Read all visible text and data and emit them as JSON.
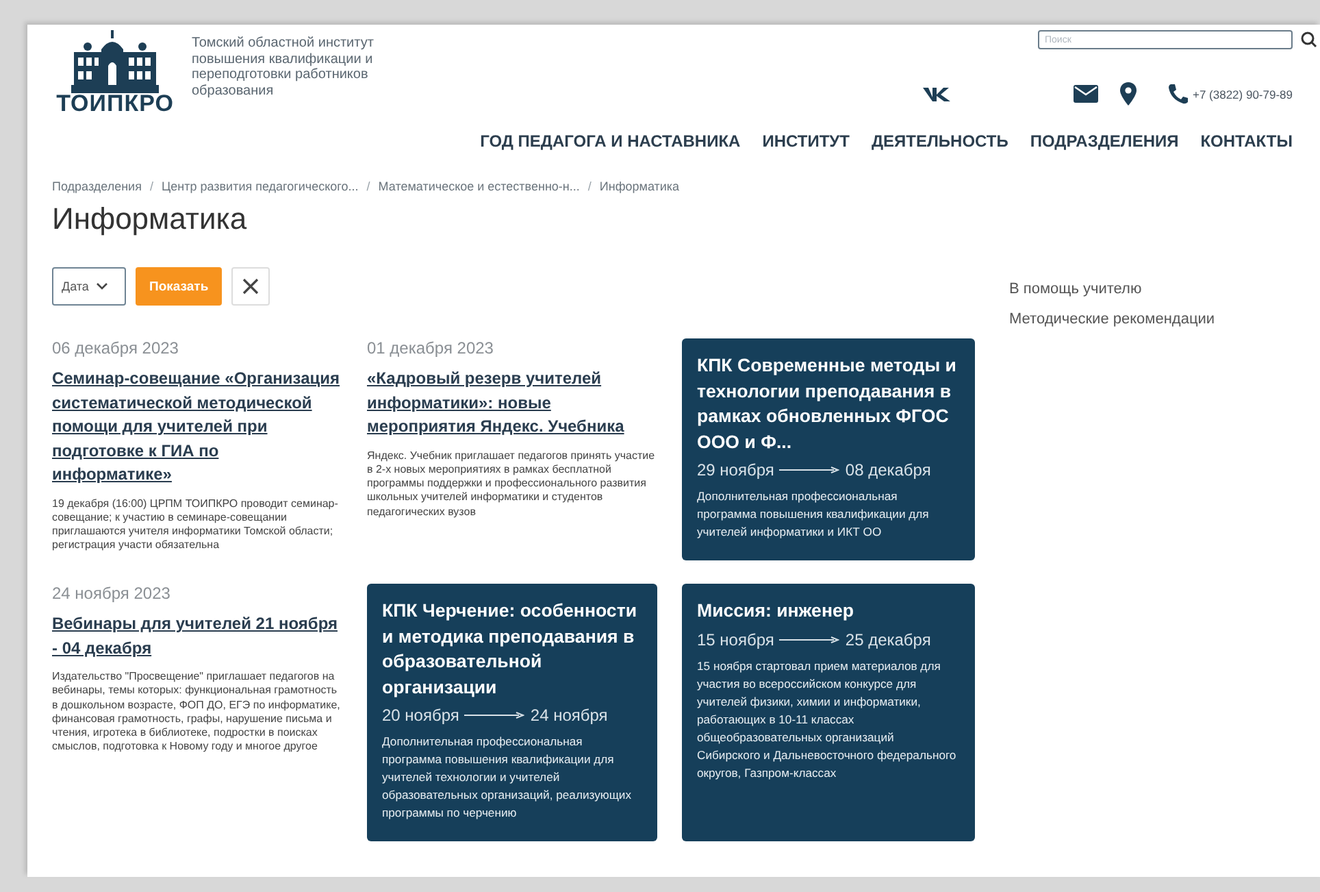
{
  "header": {
    "logo_text": "ТОИПКРО",
    "org_name": "Томский областной институт повышения квалификации и переподготовки работников образования",
    "search": {
      "placeholder": "Поиск"
    },
    "phone": "+7 (3822) 90-79-89",
    "nav": [
      "ГОД ПЕДАГОГА И НАСТАВНИКА",
      "ИНСТИТУТ",
      "ДЕЯТЕЛЬНОСТЬ",
      "ПОДРАЗДЕЛЕНИЯ",
      "КОНТАКТЫ"
    ]
  },
  "breadcrumbs": [
    {
      "label": "Подразделения"
    },
    {
      "separator": "/",
      "label": "Центр развития педагогического..."
    },
    {
      "separator": "/",
      "label": "Математическое и естественно-н..."
    },
    {
      "separator": "/",
      "label": "Информатика"
    }
  ],
  "page_title": "Информатика",
  "filter": {
    "select": "Дата",
    "show_button": "Показать"
  },
  "items": [
    {
      "kind": "news",
      "date": "06 декабря 2023",
      "title": "Семинар-совещание «Организация систематической методической помощи для учителей при подготовке к ГИА по информатике»",
      "summary": "19 декабря (16:00) ЦРПМ ТОИПКРО проводит семинар-совещание; к участию в семинаре-совещании приглашаются учителя информатики Томской области; регистрация участи  обязательна"
    },
    {
      "kind": "news",
      "date": "01 декабря 2023",
      "title": "«Кадровый резерв учителей информатики»: новые мероприятия Яндекс. Учебника",
      "summary": "Яндекс. Учебник приглашает педагогов принять участие в 2-х новых мероприятиях в рамках бесплатной программы поддержки и профессионального развития школьных учителей информатики и студентов педагогических вузов"
    },
    {
      "kind": "event",
      "title": "КПК Современные методы и технологии преподавания в рамках обновленных ФГОС ООО и Ф...",
      "date_from": "29 ноября",
      "date_to": "08 декабря",
      "summary": "Дополнительная профессиональная программа повышения квалификации для учителей информатики и ИКТ ОО"
    },
    {
      "kind": "news",
      "date": "24 ноября 2023",
      "title": "Вебинары для учителей 21 ноября - 04 декабря",
      "summary": "Издательство \"Просвещение\" приглашает педагогов на вебинары, темы которых: функциональная грамотность в дошкольном возрасте, ФОП ДО, ЕГЭ по информатике, финансовая грамотность, графы, нарушение письма и чтения, игротека в библиотеке, подростки в поисках смыслов, подготовка к Новому году и многое другое"
    },
    {
      "kind": "event",
      "title": "КПК Черчение: особенности и методика преподавания в образовательной организации",
      "date_from": "20 ноября",
      "date_to": "24 ноября",
      "summary": "Дополнительная профессиональная программа повышения квалификации для учителей технологии и учителей образовательных организаций, реализующих программы по черчению"
    },
    {
      "kind": "event",
      "title": "Миссия: инженер",
      "date_from": "15 ноября",
      "date_to": "25 декабря",
      "summary": "15 ноября стартовал прием материалов для участия во всероссийском конкурсе для учителей физики, химии и информатики, работающих в 10-11 классах общеобразовательных организаций Сибирского и Дальневосточного федерального округов, Газпром-классах"
    }
  ],
  "sidebar_links": [
    "В помощь учителю",
    "Методические рекомендации"
  ]
}
